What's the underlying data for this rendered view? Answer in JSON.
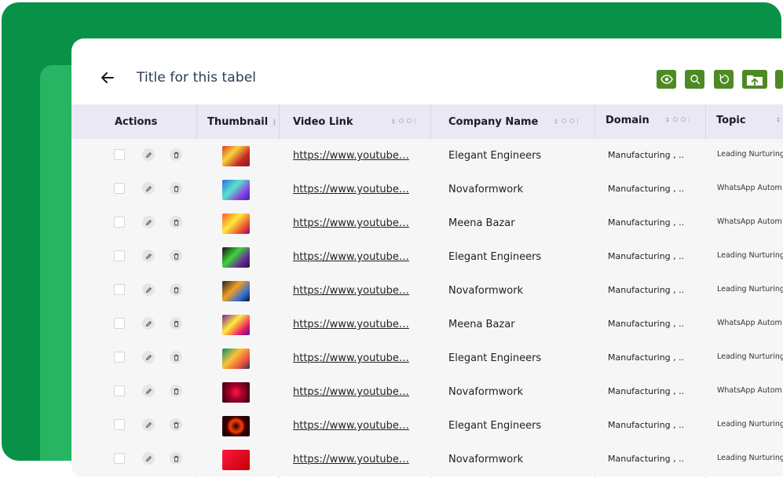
{
  "header": {
    "title": "Title for this tabel"
  },
  "columns": {
    "actions": "Actions",
    "thumbnail": "Thumbnail",
    "video_link": "Video Link",
    "company_name": "Company Name",
    "domain": "Domain",
    "topic": "Topic"
  },
  "rows": [
    {
      "video_link": "https://www.youtube…",
      "company": "Elegant Engineers",
      "domain": "Manufacturing , ..",
      "topic": "Leading Nurturing",
      "thumb": "thumb-1"
    },
    {
      "video_link": "https://www.youtube…",
      "company": "Novaformwork",
      "domain": "Manufacturing , ..",
      "topic": "WhatsApp Autom",
      "thumb": "thumb-2"
    },
    {
      "video_link": "https://www.youtube…",
      "company": "Meena Bazar",
      "domain": "Manufacturing , ..",
      "topic": "WhatsApp Autom",
      "thumb": "thumb-3"
    },
    {
      "video_link": "https://www.youtube…",
      "company": "Elegant Engineers",
      "domain": "Manufacturing , ..",
      "topic": "Leading Nurturing",
      "thumb": "thumb-4"
    },
    {
      "video_link": "https://www.youtube…",
      "company": "Novaformwork",
      "domain": "Manufacturing , ..",
      "topic": "Leading Nurturing",
      "thumb": "thumb-5"
    },
    {
      "video_link": "https://www.youtube…",
      "company": "Meena Bazar",
      "domain": "Manufacturing , ..",
      "topic": "WhatsApp Autom",
      "thumb": "thumb-6"
    },
    {
      "video_link": "https://www.youtube…",
      "company": "Elegant Engineers",
      "domain": "Manufacturing , ..",
      "topic": "Leading Nurturing",
      "thumb": "thumb-7"
    },
    {
      "video_link": "https://www.youtube…",
      "company": "Novaformwork",
      "domain": "Manufacturing , ..",
      "topic": "WhatsApp Autom",
      "thumb": "thumb-8"
    },
    {
      "video_link": "https://www.youtube…",
      "company": "Elegant Engineers",
      "domain": "Manufacturing , ..",
      "topic": "Leading Nurturing",
      "thumb": "thumb-9"
    },
    {
      "video_link": "https://www.youtube…",
      "company": "Novaformwork",
      "domain": "Manufacturing , ..",
      "topic": "Leading Nurturing",
      "thumb": "thumb-10"
    }
  ],
  "toolbar": {
    "icons": [
      "eye-icon",
      "search-icon",
      "refresh-icon",
      "upload-icon",
      "more-icon"
    ]
  },
  "colors": {
    "brand_dark": "#0a9148",
    "brand_light": "#27b463",
    "button": "#4e8a24",
    "header_bg": "#e9e8f4"
  }
}
